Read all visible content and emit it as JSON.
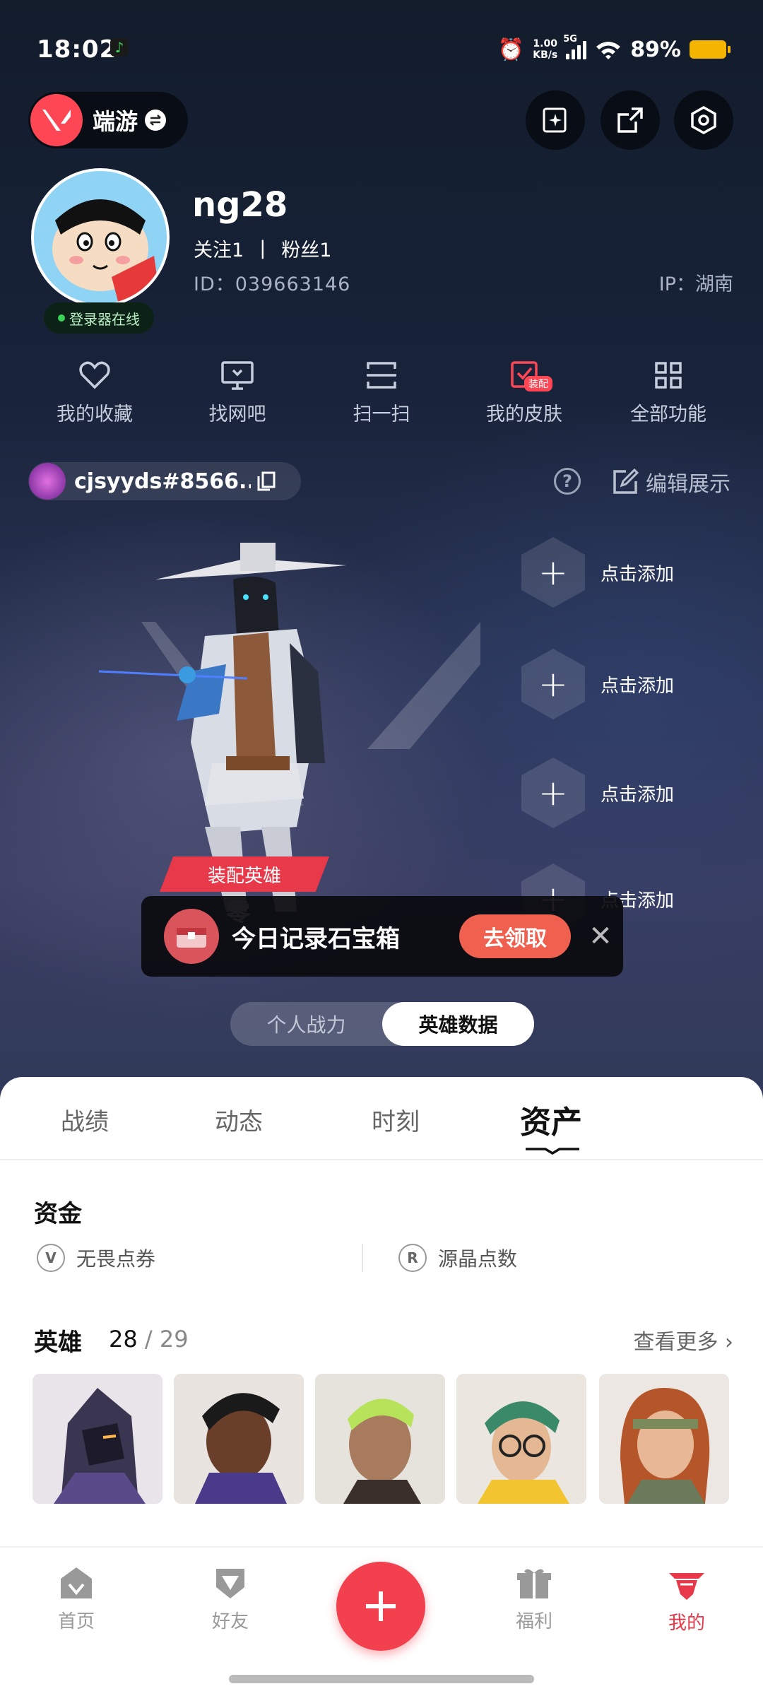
{
  "status_bar": {
    "time": "18:02",
    "speed_value": "1.00",
    "speed_unit": "KB/s",
    "network": "5G",
    "battery": "89%"
  },
  "header": {
    "game_name": "端游"
  },
  "profile": {
    "username": "ng28",
    "following_label": "关注",
    "following_count": "1",
    "divider": "|",
    "followers_label": "粉丝",
    "followers_count": "1",
    "uid": "ID：039663146",
    "ip": "IP：湖南",
    "online_status": "登录器在线"
  },
  "quick_actions": [
    {
      "label": "我的收藏",
      "icon": "heart-icon"
    },
    {
      "label": "找网吧",
      "icon": "monitor-icon"
    },
    {
      "label": "扫一扫",
      "icon": "scan-icon"
    },
    {
      "label": "我的皮肤",
      "icon": "skin-icon",
      "badge": "装配"
    },
    {
      "label": "全部功能",
      "icon": "grid-icon"
    }
  ],
  "player": {
    "tag": "cjsyyds#8566..."
  },
  "showcase": {
    "edit_label": "编辑展示",
    "add_slots": [
      "点击添加",
      "点击添加",
      "点击添加",
      "点击添加"
    ],
    "equip_label": "装配英雄",
    "agent_name": "零"
  },
  "chest_banner": {
    "text": "今日记录石宝箱",
    "button": "去领取"
  },
  "segment": {
    "options": [
      "个人战力",
      "英雄数据"
    ],
    "active": "英雄数据"
  },
  "tabs": {
    "items": [
      "战绩",
      "动态",
      "时刻",
      "资产"
    ],
    "active": "资产"
  },
  "assets": {
    "funds_title": "资金",
    "funds": [
      "无畏点券",
      "源晶点数"
    ],
    "heroes_title": "英雄",
    "heroes_owned": "28",
    "heroes_total": "29",
    "see_more": "查看更多"
  },
  "bottom_nav": {
    "items": [
      "首页",
      "好友",
      "福利",
      "我的"
    ],
    "active": "我的"
  },
  "colors": {
    "accent": "#e8394a",
    "claim": "#f0604f",
    "online": "#3ad35a"
  }
}
